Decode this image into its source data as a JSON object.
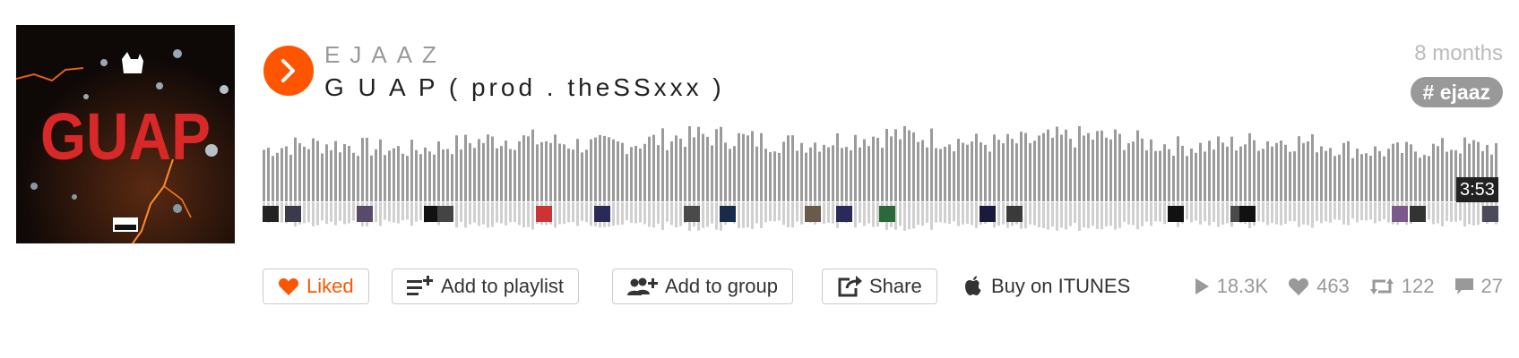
{
  "track": {
    "artist": "EJAAZ",
    "title": "G U A P ( prod . theSSxxx )",
    "posted": "8 months",
    "tag": "# ejaaz",
    "duration": "3:53",
    "artwork_text": "GUAP"
  },
  "actions": {
    "liked": "Liked",
    "add_to_playlist": "Add to playlist",
    "add_to_group": "Add to group",
    "share": "Share",
    "buy": "Buy on ITUNES"
  },
  "stats": {
    "plays": "18.3K",
    "likes": "463",
    "reposts": "122",
    "comments": "27"
  },
  "colors": {
    "accent": "#ff5500",
    "wave_top": "#9b9b9b",
    "wave_bottom": "#d0d0d0"
  },
  "icons": [
    "play-icon",
    "heart-icon",
    "add-to-playlist-icon",
    "add-to-group-icon",
    "share-icon",
    "apple-icon",
    "play-count-icon",
    "like-count-icon",
    "repost-icon",
    "comment-icon"
  ]
}
